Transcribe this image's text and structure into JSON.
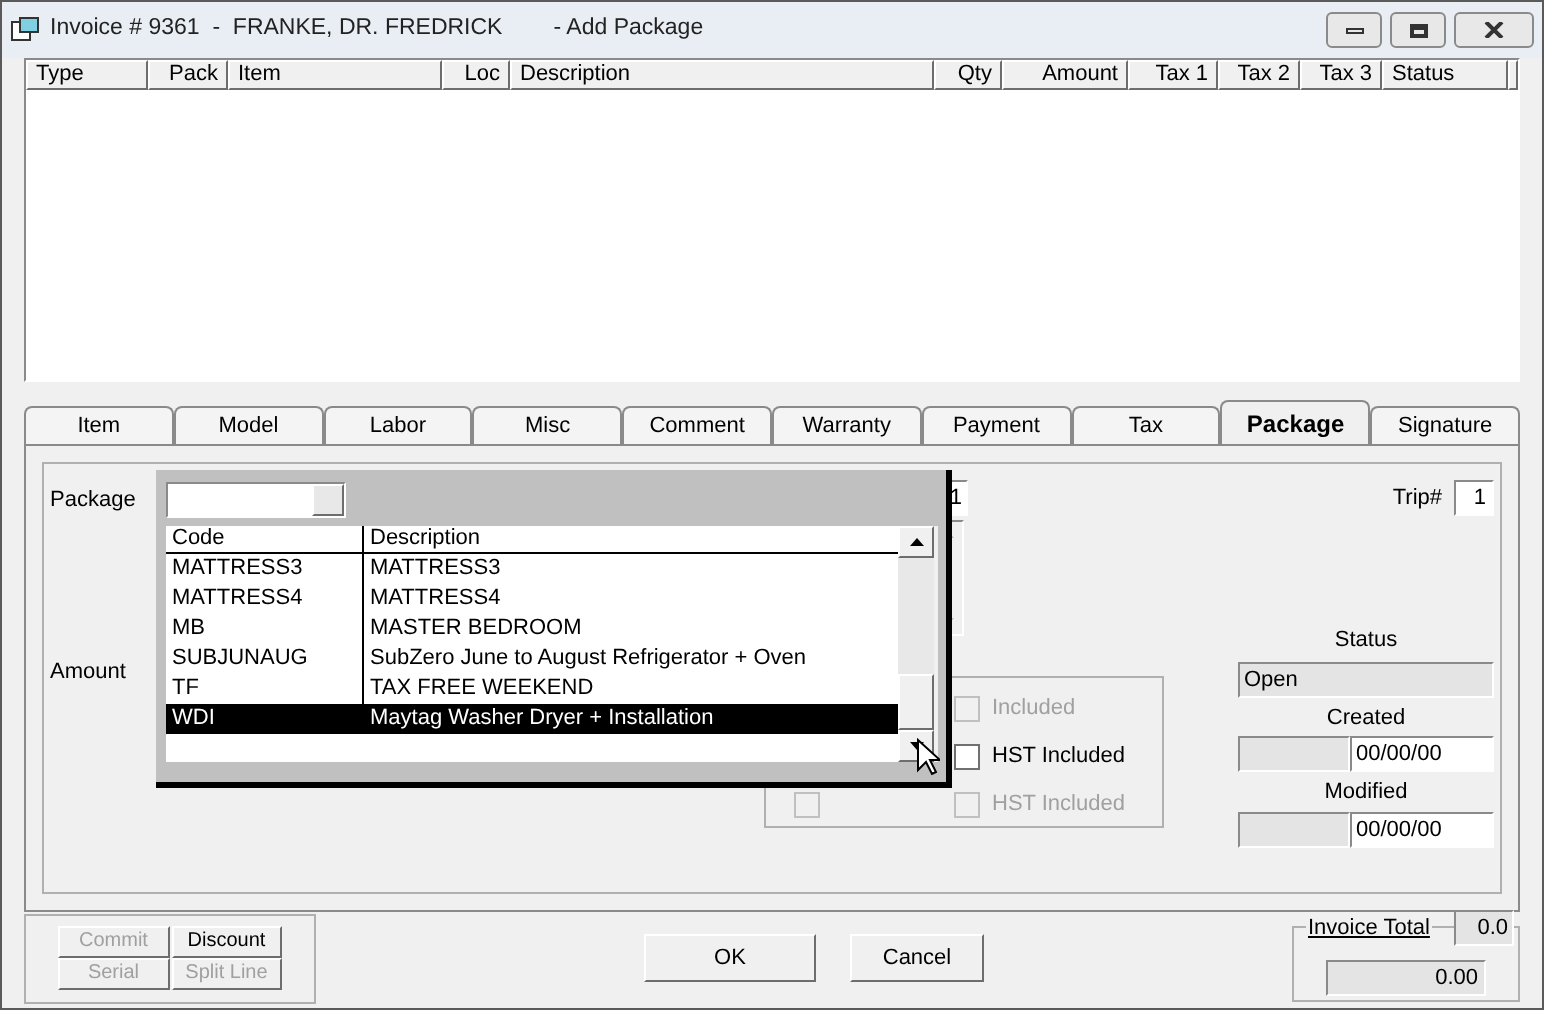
{
  "window": {
    "title": "Invoice # 9361  -  FRANKE, DR. FREDRICK        - Add Package"
  },
  "grid": {
    "columns": [
      {
        "label": "Type"
      },
      {
        "label": "Pack"
      },
      {
        "label": "Item"
      },
      {
        "label": "Loc"
      },
      {
        "label": "Description"
      },
      {
        "label": "Qty"
      },
      {
        "label": "Amount"
      },
      {
        "label": "Tax 1"
      },
      {
        "label": "Tax 2"
      },
      {
        "label": "Tax 3"
      },
      {
        "label": "Status"
      }
    ]
  },
  "tabs": [
    {
      "label": "Item",
      "selected": false
    },
    {
      "label": "Model",
      "selected": false
    },
    {
      "label": "Labor",
      "selected": false
    },
    {
      "label": "Misc",
      "selected": false
    },
    {
      "label": "Comment",
      "selected": false
    },
    {
      "label": "Warranty",
      "selected": false
    },
    {
      "label": "Payment",
      "selected": false
    },
    {
      "label": "Tax",
      "selected": false
    },
    {
      "label": "Package",
      "selected": true
    },
    {
      "label": "Signature",
      "selected": false
    }
  ],
  "form": {
    "package_label": "Package",
    "amount_label": "Amount",
    "hidden_field": "1",
    "trip_label": "Trip#",
    "trip_value": "1",
    "checkboxes": [
      {
        "label": "Included",
        "checked": false,
        "disabled": true
      },
      {
        "label": "HST Included",
        "checked": false,
        "disabled": false
      },
      {
        "checked": false,
        "disabled": true
      },
      {
        "label": "HST Included",
        "checked": false,
        "disabled": true
      }
    ],
    "status": {
      "label": "Status",
      "value": "Open"
    },
    "created": {
      "label": "Created",
      "value": "00/00/00"
    },
    "modified": {
      "label": "Modified",
      "value": "00/00/00"
    }
  },
  "dropdown": {
    "columns": [
      "Code",
      "Description"
    ],
    "rows": [
      {
        "code": "MATTRESS3",
        "description": "MATTRESS3",
        "selected": false
      },
      {
        "code": "MATTRESS4",
        "description": "MATTRESS4",
        "selected": false
      },
      {
        "code": "MB",
        "description": "MASTER BEDROOM",
        "selected": false
      },
      {
        "code": "SUBJUNAUG",
        "description": "SubZero June to August Refrigerator + Oven",
        "selected": false
      },
      {
        "code": "TF",
        "description": "TAX FREE WEEKEND",
        "selected": false
      },
      {
        "code": "WDI",
        "description": "Maytag Washer Dryer + Installation",
        "selected": true
      }
    ]
  },
  "side_buttons": [
    {
      "label": "Commit",
      "disabled": true
    },
    {
      "label": "Discount",
      "disabled": false
    },
    {
      "label": "Serial",
      "disabled": true
    },
    {
      "label": "Split Line",
      "disabled": true
    }
  ],
  "buttons": [
    "OK",
    "Cancel"
  ],
  "invoice_total": {
    "label": "Invoice Total",
    "count": "0.0",
    "value": "0.00"
  }
}
